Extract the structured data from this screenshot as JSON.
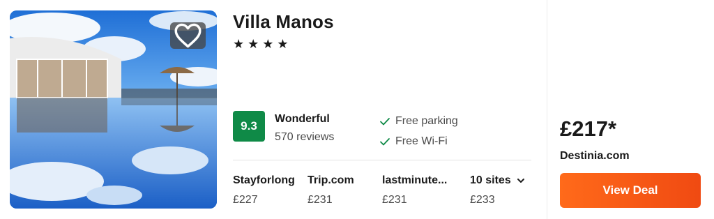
{
  "hotel": {
    "name": "Villa Manos",
    "stars_text": "★★★★",
    "star_count": 4
  },
  "rating": {
    "score": "9.3",
    "label": "Wonderful",
    "reviews": "570 reviews",
    "badge_color": "#0f8a47"
  },
  "amenities": [
    {
      "label": "Free parking",
      "icon": "check-icon"
    },
    {
      "label": "Free Wi-Fi",
      "icon": "check-icon"
    }
  ],
  "providers": [
    {
      "name": "Stayforlong",
      "price": "£227"
    },
    {
      "name": "Trip.com",
      "price": "£231"
    },
    {
      "name": "lastminute...",
      "price": "£231"
    },
    {
      "name": "10 sites",
      "price": "£233"
    }
  ],
  "deal": {
    "price": "£217*",
    "site": "Destinia.com",
    "button_label": "View Deal",
    "button_color": "#f25a16"
  },
  "icons": {
    "favorite": "heart-icon",
    "sites_dropdown": "chevron-down-icon"
  }
}
